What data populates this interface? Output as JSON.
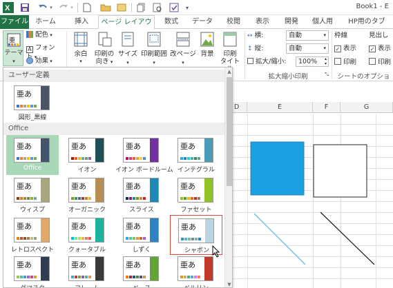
{
  "window": {
    "title": "Book1 - E"
  },
  "qat": {
    "save_icon": "save-icon",
    "undo_icon": "undo-icon",
    "redo_icon": "redo-icon",
    "new_icon": "new-document-icon",
    "open_icon": "open-folder-icon",
    "print_preview_icon": "print-preview-icon",
    "customize_icon": "customize-qat-icon"
  },
  "tabs": {
    "file": "ファイル",
    "home": "ホーム",
    "insert": "挿入",
    "page_layout": "ページ レイアウト",
    "formulas": "数式",
    "data": "データ",
    "review": "校閲",
    "view": "表示",
    "developer": "開発",
    "personal": "個人用",
    "hp": "HP用のタブ"
  },
  "ribbon": {
    "themes": "テーマ",
    "colors": "配色",
    "fonts": "フォント",
    "effects": "効果",
    "margins": "余白",
    "orientation_1": "印刷の",
    "orientation_2": "向き",
    "size": "サイズ",
    "print_area": "印刷範囲",
    "breaks": "改ページ",
    "background": "背景",
    "print_titles_1": "印刷",
    "print_titles_2": "タイトル",
    "width_label": "横:",
    "width_value": "自動",
    "height_label": "縦:",
    "height_value": "自動",
    "scale_label": "拡大/縮小:",
    "scale_value": "100%",
    "scale_group": "拡大縮小印刷",
    "gridlines": "枠線",
    "headings": "見出し",
    "view_1": "表示",
    "print_1": "印刷",
    "view_2": "表示",
    "print_2": "印刷",
    "sheet_options": "シートのオプション"
  },
  "sheet": {
    "columns": [
      "D",
      "E",
      "F",
      "G"
    ]
  },
  "theme_panel": {
    "section_user": "ユーザー定義",
    "section_office": "Office",
    "glyph": "亜あ",
    "user_themes": [
      {
        "label": "図形_黒線",
        "accent": "#4a5668",
        "dots": [
          "#4472c4",
          "#ed7d31",
          "#a5a5a5",
          "#ffc000",
          "#5b9bd5",
          "#70ad47"
        ]
      }
    ],
    "office_themes": [
      {
        "label": "Office",
        "accent": "#44546a",
        "dots": [
          "#4472c4",
          "#ed7d31",
          "#a5a5a5",
          "#ffc000",
          "#5b9bd5",
          "#70ad47"
        ],
        "selected": true
      },
      {
        "label": "イオン",
        "accent": "#1e5155",
        "dots": [
          "#b01513",
          "#ea6312",
          "#e6b729",
          "#6aac90",
          "#5f9c9d",
          "#9e5e9b"
        ]
      },
      {
        "label": "イオン ボードルーム",
        "accent": "#7030a0",
        "dots": [
          "#b31166",
          "#e33d6f",
          "#e45f3c",
          "#e9a23b",
          "#ebd34f",
          "#4a8cc9"
        ]
      },
      {
        "label": "インテグラル",
        "accent": "#4a9bb3",
        "dots": [
          "#1cade4",
          "#2683c6",
          "#27ced7",
          "#42ba97",
          "#3e8853",
          "#62a39f"
        ]
      },
      {
        "label": "ウィスプ",
        "accent": "#a9a57c",
        "dots": [
          "#a53010",
          "#de7e18",
          "#9f8351",
          "#728653",
          "#92aa4c",
          "#6aac91"
        ]
      },
      {
        "label": "オーガニック",
        "accent": "#b68f52",
        "dots": [
          "#83992a",
          "#3c9770",
          "#44709d",
          "#a23c33",
          "#d97828",
          "#deb340"
        ]
      },
      {
        "label": "スライス",
        "accent": "#1e88b7",
        "dots": [
          "#052f61",
          "#a50e82",
          "#14967c",
          "#6a9e1f",
          "#e87d37",
          "#c62324"
        ]
      },
      {
        "label": "ファセット",
        "accent": "#90c226",
        "dots": [
          "#90c226",
          "#54a021",
          "#e6b91e",
          "#e76618",
          "#c42f1a",
          "#918655"
        ]
      },
      {
        "label": "レトロスペクト",
        "accent": "#e0a86b",
        "dots": [
          "#e48312",
          "#bd582c",
          "#865640",
          "#9b8357",
          "#c2bc80",
          "#94a088"
        ]
      },
      {
        "label": "クォータブル",
        "accent": "#1ab39f",
        "dots": [
          "#00c6bb",
          "#6feba0",
          "#b6df5e",
          "#efb251",
          "#ef755f",
          "#ed515c"
        ]
      },
      {
        "label": "しずく",
        "accent": "#2e83c3",
        "dots": [
          "#2fa3ee",
          "#4bcaad",
          "#86c157",
          "#d99c3f",
          "#ce6633",
          "#a35dd1"
        ]
      },
      {
        "label": "シャボン",
        "accent": "#bcd4de",
        "dots": [
          "#3494ba",
          "#58b6c0",
          "#75bda7",
          "#7a8c8e",
          "#84acb6",
          "#2683c6"
        ],
        "hovered": true
      },
      {
        "label": "ダマスク",
        "accent": "#2e3d50",
        "dots": [
          "#9ec544",
          "#50bea3",
          "#4a9ccc",
          "#9a66ca",
          "#c54f71",
          "#de9c3c"
        ]
      },
      {
        "label": "フレーム",
        "accent": "#3a3a3a",
        "dots": [
          "#40a7c2",
          "#c23e3e",
          "#7f9a48",
          "#8064a2",
          "#4bacc6",
          "#f79646"
        ]
      },
      {
        "label": "ベース",
        "accent": "#64a436",
        "dots": [
          "#f07f09",
          "#9f2936",
          "#1b587c",
          "#4e8542",
          "#604878",
          "#c19859"
        ]
      },
      {
        "label": "ベルリン",
        "accent": "#c0392b",
        "dots": [
          "#f09415",
          "#c1b56b",
          "#4baf73",
          "#5aa6c0",
          "#d17df9",
          "#fa7e5c"
        ]
      }
    ]
  }
}
